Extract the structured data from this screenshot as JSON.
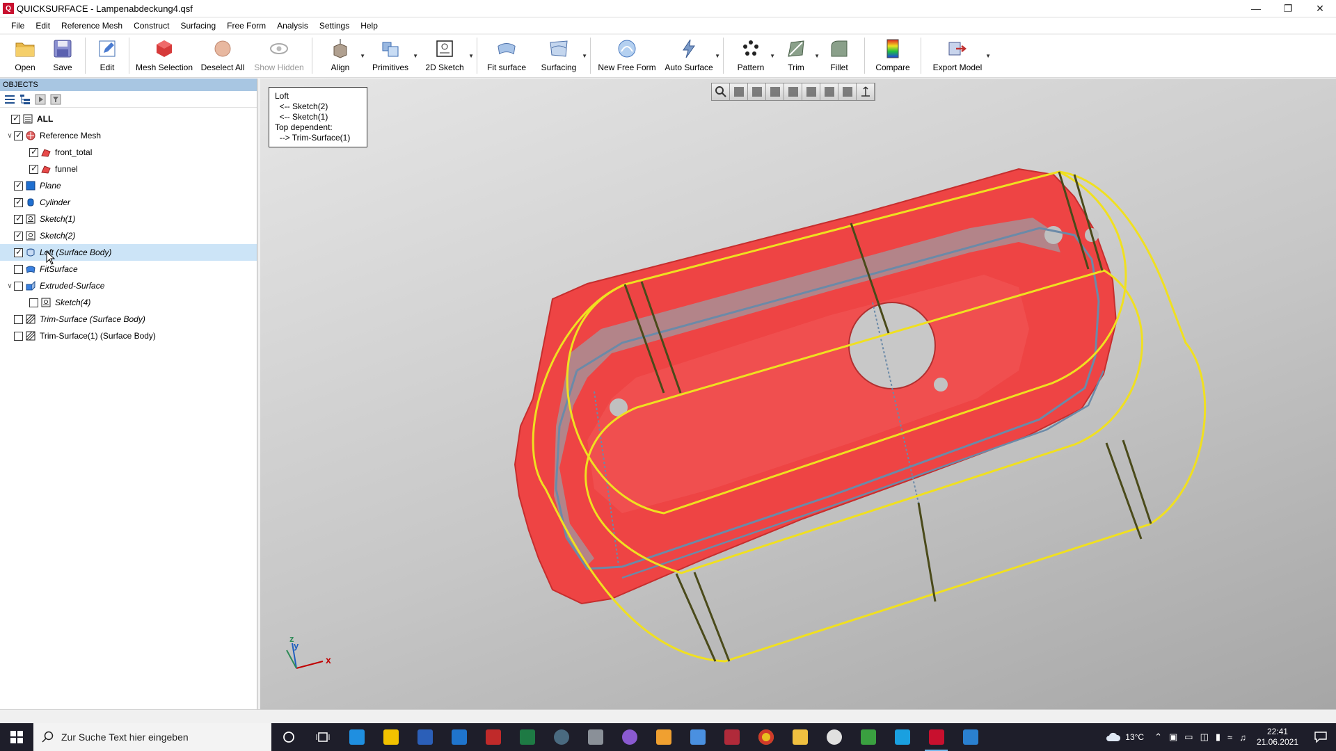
{
  "window": {
    "title": "QUICKSURFACE - Lampenabdeckung4.qsf",
    "app_icon": "Q",
    "controls": [
      "minimize",
      "restore",
      "close"
    ]
  },
  "menu": [
    "File",
    "Edit",
    "Reference Mesh",
    "Construct",
    "Surfacing",
    "Free Form",
    "Analysis",
    "Settings",
    "Help"
  ],
  "toolbar": {
    "open": "Open",
    "save": "Save",
    "edit": "Edit",
    "mesh_selection": "Mesh Selection",
    "deselect_all": "Deselect All",
    "show_hidden": "Show Hidden",
    "align": "Align",
    "primitives": "Primitives",
    "sketch_2d": "2D Sketch",
    "fit_surface": "Fit surface",
    "surfacing": "Surfacing",
    "new_free_form": "New Free Form",
    "auto_surface": "Auto Surface",
    "pattern": "Pattern",
    "trim": "Trim",
    "fillet": "Fillet",
    "compare": "Compare",
    "export_model": "Export Model"
  },
  "objects": {
    "header": "OBJECTS",
    "items": [
      {
        "label": "ALL",
        "checked": true,
        "style": "bold",
        "icon": "list-icon"
      },
      {
        "label": "Reference Mesh",
        "checked": true,
        "style": "normal",
        "icon": "mesh-group-icon"
      },
      {
        "label": "front_total",
        "checked": true,
        "style": "normal",
        "icon": "mesh-icon"
      },
      {
        "label": "funnel",
        "checked": true,
        "style": "normal",
        "icon": "mesh-icon"
      },
      {
        "label": "Plane",
        "checked": true,
        "style": "italic",
        "icon": "plane-icon"
      },
      {
        "label": "Cylinder",
        "checked": true,
        "style": "italic",
        "icon": "cylinder-icon"
      },
      {
        "label": "Sketch(1)",
        "checked": true,
        "style": "italic",
        "icon": "sketch-icon"
      },
      {
        "label": "Sketch(2)",
        "checked": true,
        "style": "italic",
        "icon": "sketch-icon"
      },
      {
        "label": "Loft (Surface Body)",
        "checked": true,
        "style": "italic",
        "icon": "loft-icon",
        "selected": true
      },
      {
        "label": "FitSurface",
        "checked": false,
        "style": "italic",
        "icon": "fit-surface-icon"
      },
      {
        "label": "Extruded-Surface",
        "checked": false,
        "style": "italic",
        "icon": "extrude-icon"
      },
      {
        "label": "Sketch(4)",
        "checked": false,
        "style": "italic",
        "icon": "sketch-icon"
      },
      {
        "label": "Trim-Surface (Surface Body)",
        "checked": false,
        "style": "italic",
        "icon": "trim-icon"
      },
      {
        "label": "Trim-Surface(1) (Surface Body)",
        "checked": false,
        "style": "normal",
        "icon": "trim-icon"
      }
    ]
  },
  "info_box": {
    "text": "Loft\n  <-- Sketch(2)\n  <-- Sketch(1)\nTop dependent:\n  --> Trim-Surface(1)"
  },
  "axis": {
    "x": "x",
    "y": "y",
    "z": "z"
  },
  "colors": {
    "mesh": "#ee4444",
    "loft_edges": "#f0e020",
    "section_lines": "#4a4a1a",
    "selection_bg": "#cce4f7",
    "panel_header": "#a8c6e2"
  },
  "taskbar": {
    "search_placeholder": "Zur Suche Text hier eingeben",
    "temperature": "13°C",
    "time": "22:41",
    "date": "21.06.2021"
  }
}
